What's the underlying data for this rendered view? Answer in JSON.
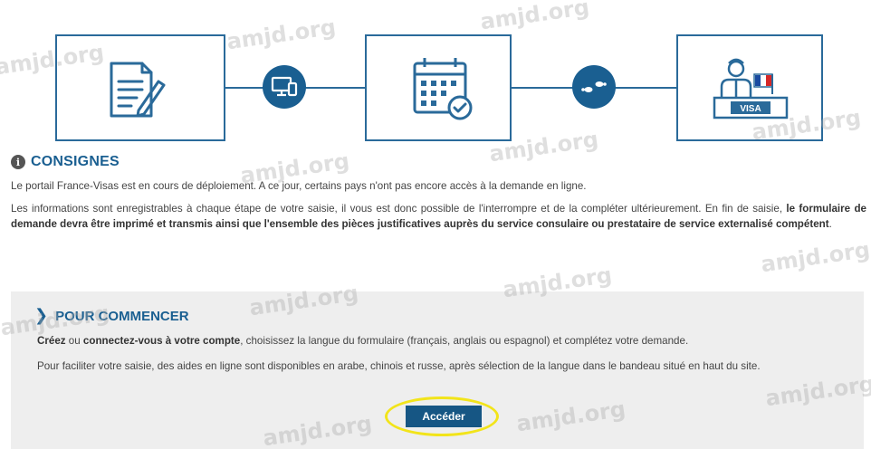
{
  "steps": {
    "visa_label": "VISA"
  },
  "consignes": {
    "info_glyph": "i",
    "heading": "CONSIGNES",
    "p1": "Le portail France-Visas est en cours de déploiement. A ce jour, certains pays n'ont pas encore accès à la demande en ligne.",
    "p2_part1": "Les informations sont enregistrables à chaque étape de votre saisie, il vous est donc possible de l'interrompre et de la compléter ultérieurement. En fin de saisie, ",
    "p2_bold": "le formulaire de demande devra être imprimé et transmis ainsi que l'ensemble des pièces justificatives auprès du service consulaire ou prestataire de service externalisé compétent",
    "p2_end": "."
  },
  "panel": {
    "chevron": "❯",
    "heading": "POUR COMMENCER",
    "p1_bold1": "Créez",
    "p1_mid": " ou ",
    "p1_bold2": "connectez-vous à votre compte",
    "p1_rest": ", choisissez la langue du formulaire (français, anglais ou espagnol) et complétez votre demande.",
    "p2": "Pour faciliter votre saisie, des aides en ligne sont disponibles en arabe, chinois et russe, après sélection de la langue dans le bandeau situé en haut du site.",
    "button_label": "Accéder"
  },
  "watermark": "amjd.org",
  "colors": {
    "brand_blue": "#1a5f91",
    "button_blue": "#165684",
    "highlight_yellow": "#f2e41a",
    "panel_bg": "#eeeeee"
  }
}
